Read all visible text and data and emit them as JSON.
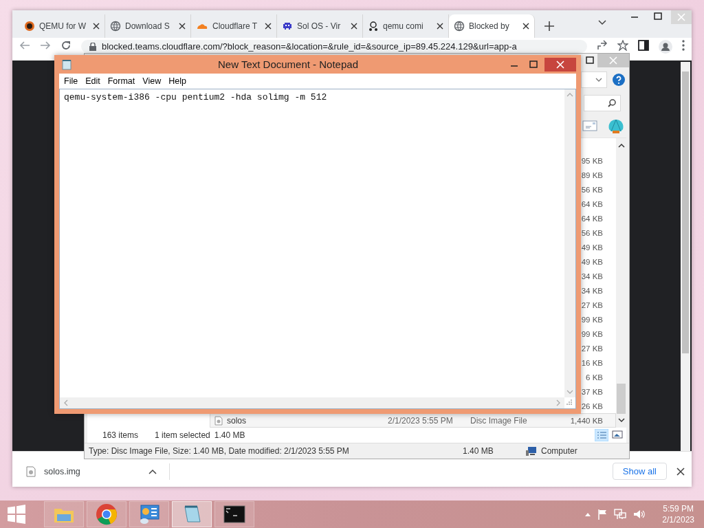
{
  "browser": {
    "tabs": [
      {
        "kind": "qemu",
        "title": "QEMU for W",
        "selected": false
      },
      {
        "kind": "globe",
        "title": "Download S",
        "selected": false
      },
      {
        "kind": "cloud",
        "title": "Cloudflare T",
        "selected": false
      },
      {
        "kind": "invader",
        "title": "Sol OS - Vir",
        "selected": false
      },
      {
        "kind": "glider",
        "title": "qemu comi",
        "selected": false
      },
      {
        "kind": "globe",
        "title": "Blocked by",
        "selected": true
      }
    ],
    "url": "blocked.teams.cloudflare.com/?block_reason=&location=&rule_id=&source_ip=89.45.224.129&url=app-a",
    "download": {
      "file": "solos.img",
      "show_all": "Show all"
    }
  },
  "explorer": {
    "rows": [
      {
        "size": "95 KB",
        "selected": false
      },
      {
        "size": "89 KB",
        "selected": false
      },
      {
        "size": "56 KB",
        "selected": false
      },
      {
        "size": "64 KB",
        "selected": false
      },
      {
        "size": "64 KB",
        "selected": false
      },
      {
        "size": "56 KB",
        "selected": false
      },
      {
        "size": "49 KB",
        "selected": false
      },
      {
        "size": "49 KB",
        "selected": false
      },
      {
        "size": "34 KB",
        "selected": false
      },
      {
        "size": "34 KB",
        "selected": false
      },
      {
        "size": "27 KB",
        "selected": false
      },
      {
        "size": "99 KB",
        "selected": false
      },
      {
        "size": "99 KB",
        "selected": false
      },
      {
        "size": "27 KB",
        "selected": false
      },
      {
        "size": "16 KB",
        "selected": false
      },
      {
        "size": "6 KB",
        "selected": false
      },
      {
        "size": "37 KB",
        "selected": false
      },
      {
        "size": "26 KB",
        "selected": false
      },
      {
        "name": "solos",
        "date": "2/1/2023 5:55 PM",
        "type": "Disc Image File",
        "size": "1,440 KB",
        "selected": true
      }
    ],
    "status": {
      "count": "163 items",
      "selection": "1 item selected",
      "selection_size": "1.40 MB"
    },
    "details": {
      "text": "Type: Disc Image File, Size: 1.40 MB, Date modified: 2/1/2023 5:55 PM",
      "size": "1.40 MB",
      "location": "Computer"
    }
  },
  "notepad": {
    "title": "New Text Document - Notepad",
    "menu": [
      "File",
      "Edit",
      "Format",
      "View",
      "Help"
    ],
    "text": "qemu-system-i386 -cpu pentium2 -hda solimg -m 512"
  },
  "taskbar": {
    "apps": [
      {
        "kind": "explorer",
        "selected": false
      },
      {
        "kind": "chrome",
        "selected": false
      },
      {
        "kind": "control-panel",
        "selected": false
      },
      {
        "kind": "notepad",
        "selected": true
      },
      {
        "kind": "cmd",
        "selected": false
      }
    ],
    "time": "5:59 PM",
    "date": "2/1/2023"
  }
}
